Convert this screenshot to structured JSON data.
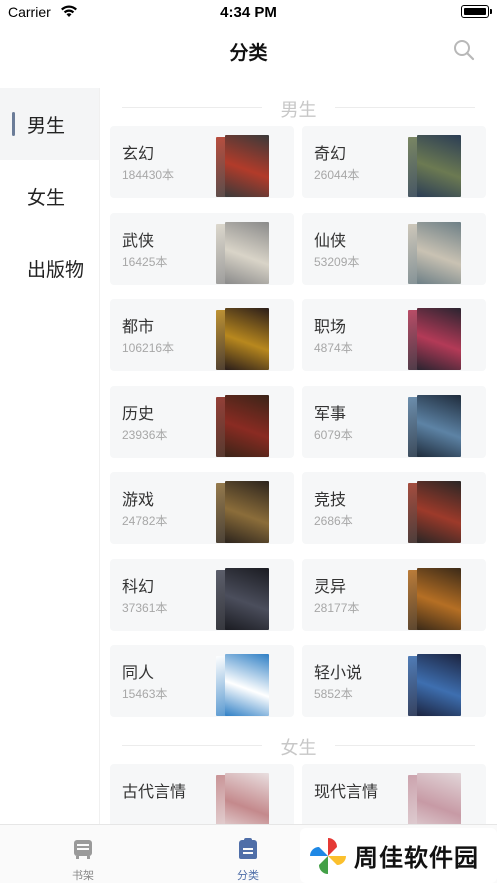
{
  "status": {
    "carrier": "Carrier",
    "time": "4:34 PM"
  },
  "nav": {
    "title": "分类"
  },
  "sidebar": {
    "items": [
      {
        "label": "男生"
      },
      {
        "label": "女生"
      },
      {
        "label": "出版物"
      }
    ]
  },
  "sections": {
    "male": {
      "title": "男生",
      "categories": [
        {
          "name": "玄幻",
          "count": "184430本",
          "cover_colors": [
            "#3a3a3a",
            "#b23b2a"
          ]
        },
        {
          "name": "奇幻",
          "count": "26044本",
          "cover_colors": [
            "#2b3d55",
            "#6c7a52"
          ]
        },
        {
          "name": "武侠",
          "count": "16425本",
          "cover_colors": [
            "#8a8a8a",
            "#d9d4c8"
          ]
        },
        {
          "name": "仙侠",
          "count": "53209本",
          "cover_colors": [
            "#6d7f86",
            "#c9c2b3"
          ]
        },
        {
          "name": "都市",
          "count": "106216本",
          "cover_colors": [
            "#2a1d1a",
            "#b8881e"
          ]
        },
        {
          "name": "职场",
          "count": "4874本",
          "cover_colors": [
            "#2a2430",
            "#b33a57"
          ]
        },
        {
          "name": "历史",
          "count": "23936本",
          "cover_colors": [
            "#3b2418",
            "#8a2b22"
          ]
        },
        {
          "name": "军事",
          "count": "6079本",
          "cover_colors": [
            "#1f2c3c",
            "#5d83a5"
          ]
        },
        {
          "name": "游戏",
          "count": "24782本",
          "cover_colors": [
            "#2c241d",
            "#8b6d3a"
          ]
        },
        {
          "name": "竞技",
          "count": "2686本",
          "cover_colors": [
            "#2a2625",
            "#9d3a2a"
          ]
        },
        {
          "name": "科幻",
          "count": "37361本",
          "cover_colors": [
            "#1b1c22",
            "#4b4e5c"
          ]
        },
        {
          "name": "灵异",
          "count": "28177本",
          "cover_colors": [
            "#3b2a18",
            "#b56f24"
          ]
        },
        {
          "name": "同人",
          "count": "15463本",
          "cover_colors": [
            "#2f7fc5",
            "#ffffff"
          ]
        },
        {
          "name": "轻小说",
          "count": "5852本",
          "cover_colors": [
            "#1c2440",
            "#3e6fb0"
          ]
        }
      ]
    },
    "female": {
      "title": "女生",
      "categories": [
        {
          "name": "古代言情",
          "count": "",
          "cover_colors": [
            "#e9dfe0",
            "#c4898c"
          ]
        },
        {
          "name": "现代言情",
          "count": "",
          "cover_colors": [
            "#e2d6d9",
            "#c79aa5"
          ]
        }
      ]
    }
  },
  "tabbar": {
    "items": [
      {
        "label": "书架"
      },
      {
        "label": "分类"
      }
    ]
  },
  "watermark": {
    "text": "周佳软件园"
  },
  "colors": {
    "accent": "#4f6ea8",
    "sidebar_indicator": "#6b7c98",
    "card_bg": "#f6f7f8"
  }
}
